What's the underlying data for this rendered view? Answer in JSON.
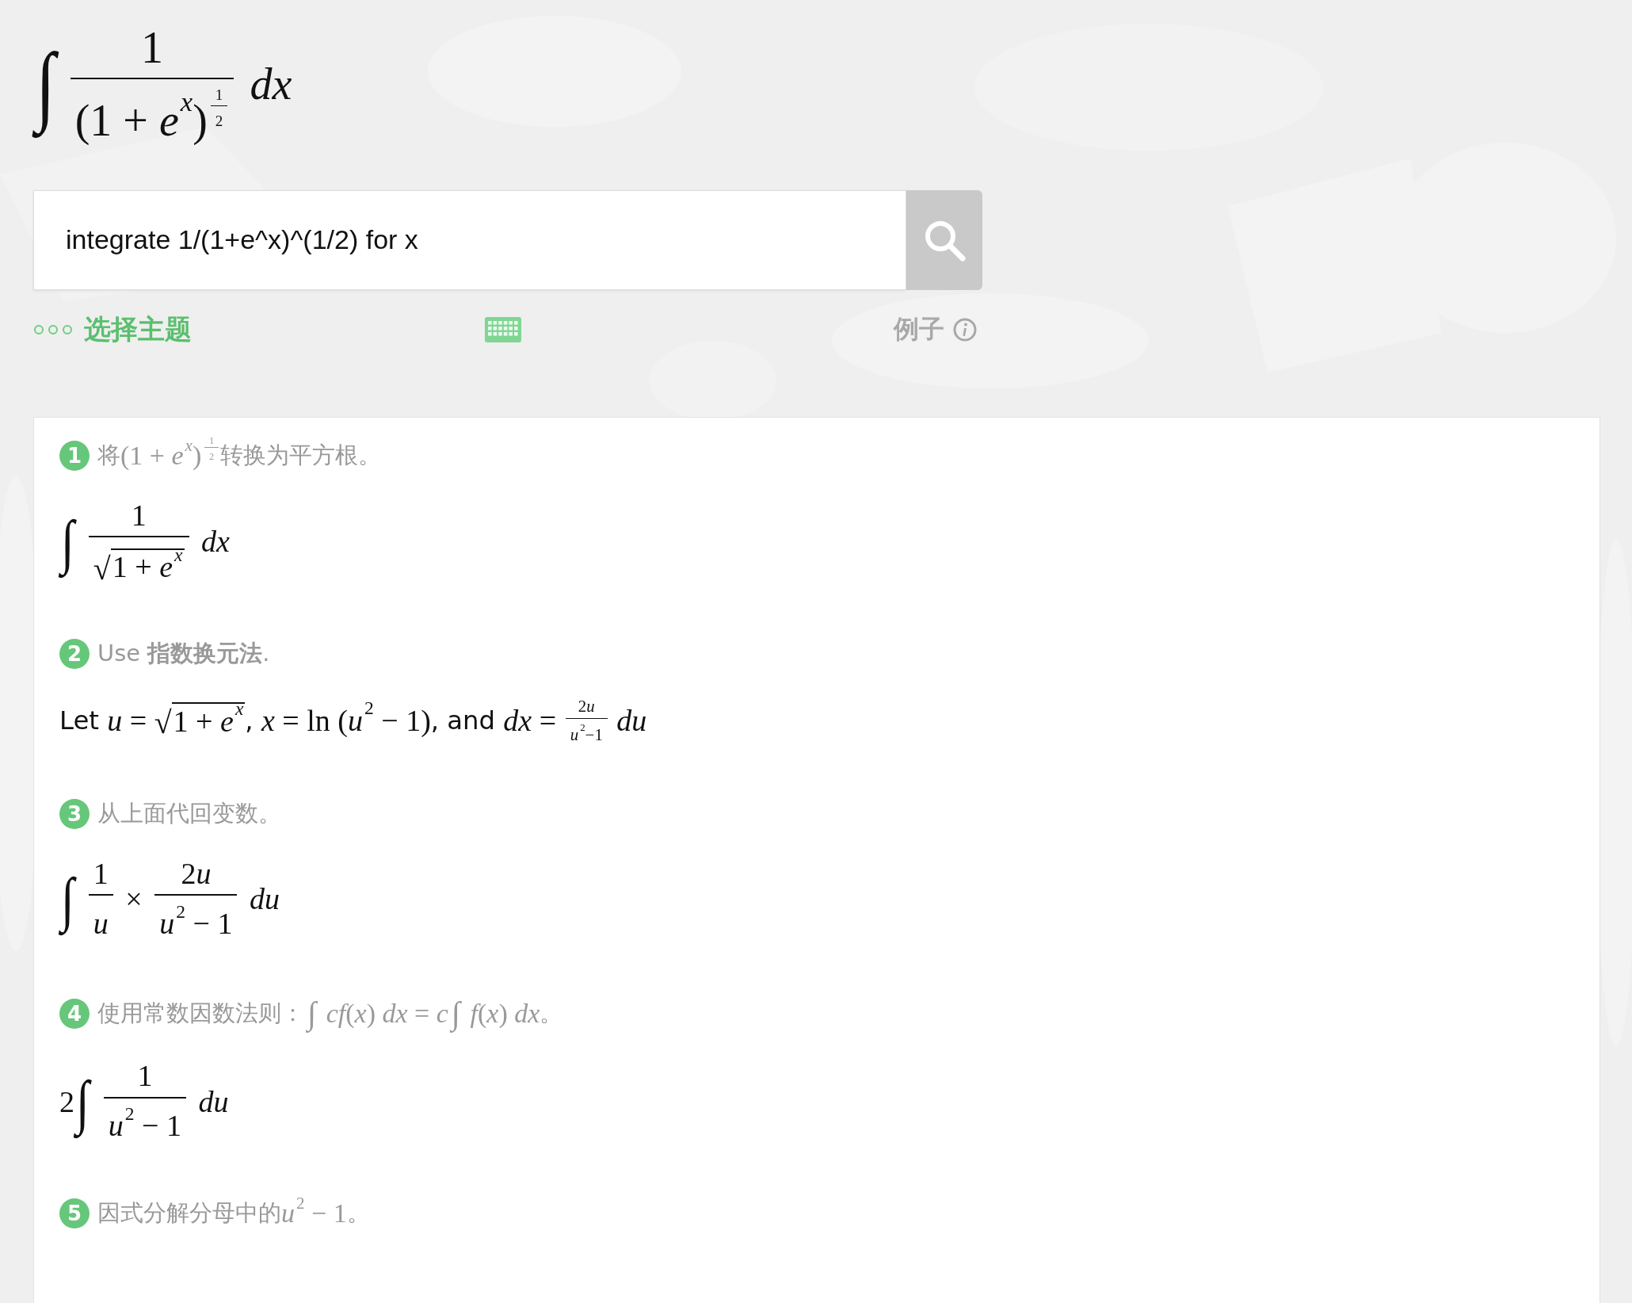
{
  "query_formula": [
    {
      "kind": "int",
      "s": "∫"
    },
    {
      "kind": "frac",
      "num": [
        "1"
      ],
      "den": [
        "(1 + ",
        {
          "kind": "sup",
          "base": [
            "*e*"
          ],
          "sup": [
            "*x*"
          ]
        },
        {
          "kind": "sup",
          "base": [
            ")"
          ],
          "sup": [
            {
              "kind": "tfrac",
              "num": [
                "1"
              ],
              "den": [
                "2"
              ]
            }
          ]
        }
      ]
    },
    " *dx*"
  ],
  "search": {
    "value": "integrate 1/(1+e^x)^(1/2) for x"
  },
  "toolbar": {
    "topic_link": "选择主题",
    "examples_link": "例子"
  },
  "steps": [
    {
      "number": "1",
      "title": [
        {
          "kind": "t",
          "s": "将"
        },
        "(1 + ",
        {
          "kind": "sup",
          "base": [
            "*e*"
          ],
          "sup": [
            "*x*"
          ]
        },
        {
          "kind": "sup",
          "base": [
            ")"
          ],
          "sup": [
            {
              "kind": "tfrac",
              "num": [
                "1"
              ],
              "den": [
                "2"
              ]
            }
          ]
        },
        {
          "kind": "t",
          "s": "转换为平方根。"
        }
      ],
      "formula": [
        {
          "kind": "int",
          "s": "∫"
        },
        {
          "kind": "frac",
          "num": [
            "1"
          ],
          "den": [
            {
              "kind": "sqrt",
              "s": "√",
              "body": [
                "1 + ",
                {
                  "kind": "sup",
                  "base": [
                    "*e*"
                  ],
                  "sup": [
                    "*x*"
                  ]
                }
              ]
            }
          ]
        },
        " *dx*"
      ]
    },
    {
      "number": "2",
      "title": [
        {
          "kind": "t",
          "s": "Use **指数换元法**."
        }
      ],
      "formula": [
        {
          "kind": "t",
          "s": "Let "
        },
        "*u* = ",
        {
          "kind": "sqrt",
          "s": "√",
          "body": [
            "1 + ",
            {
              "kind": "sup",
              "base": [
                "*e*"
              ],
              "sup": [
                "*x*"
              ]
            }
          ]
        },
        {
          "kind": "t",
          "s": ", "
        },
        "*x* = ln (",
        {
          "kind": "sup",
          "base": [
            "*u*"
          ],
          "sup": [
            "2"
          ]
        },
        " − 1)",
        {
          "kind": "t",
          "s": ", and "
        },
        "*dx* = ",
        {
          "kind": "tfrac",
          "num": [
            "2",
            "*u*"
          ],
          "den": [
            {
              "kind": "sup",
              "base": [
                "*u*"
              ],
              "sup": [
                "2"
              ]
            },
            "−1"
          ]
        },
        " *du*"
      ]
    },
    {
      "number": "3",
      "title": [
        {
          "kind": "t",
          "s": "从上面代回变数。"
        }
      ],
      "formula": [
        {
          "kind": "int",
          "s": "∫"
        },
        {
          "kind": "frac",
          "num": [
            "1"
          ],
          "den": [
            "*u*"
          ]
        },
        " × ",
        {
          "kind": "frac",
          "num": [
            "2",
            "*u*"
          ],
          "den": [
            {
              "kind": "sup",
              "base": [
                "*u*"
              ],
              "sup": [
                "2"
              ]
            },
            " − 1"
          ]
        },
        " *du*"
      ]
    },
    {
      "number": "4",
      "title": [
        {
          "kind": "t",
          "s": "使用常数因数法则："
        },
        {
          "kind": "tint",
          "s": "∫"
        },
        " *cf*(*x*) *dx* = *c*",
        {
          "kind": "tint",
          "s": "∫"
        },
        " *f*(*x*) *dx*",
        {
          "kind": "t",
          "s": "。"
        }
      ],
      "formula": [
        "2",
        {
          "kind": "int",
          "s": "∫"
        },
        {
          "kind": "frac",
          "num": [
            "1"
          ],
          "den": [
            {
              "kind": "sup",
              "base": [
                "*u*"
              ],
              "sup": [
                "2"
              ]
            },
            " − 1"
          ]
        },
        " *du*"
      ]
    },
    {
      "number": "5",
      "title": [
        {
          "kind": "t",
          "s": "因式分解分母中的"
        },
        {
          "kind": "sup",
          "base": [
            "*u*"
          ],
          "sup": [
            "2"
          ]
        },
        " − 1",
        {
          "kind": "t",
          "s": "。"
        }
      ]
    }
  ]
}
